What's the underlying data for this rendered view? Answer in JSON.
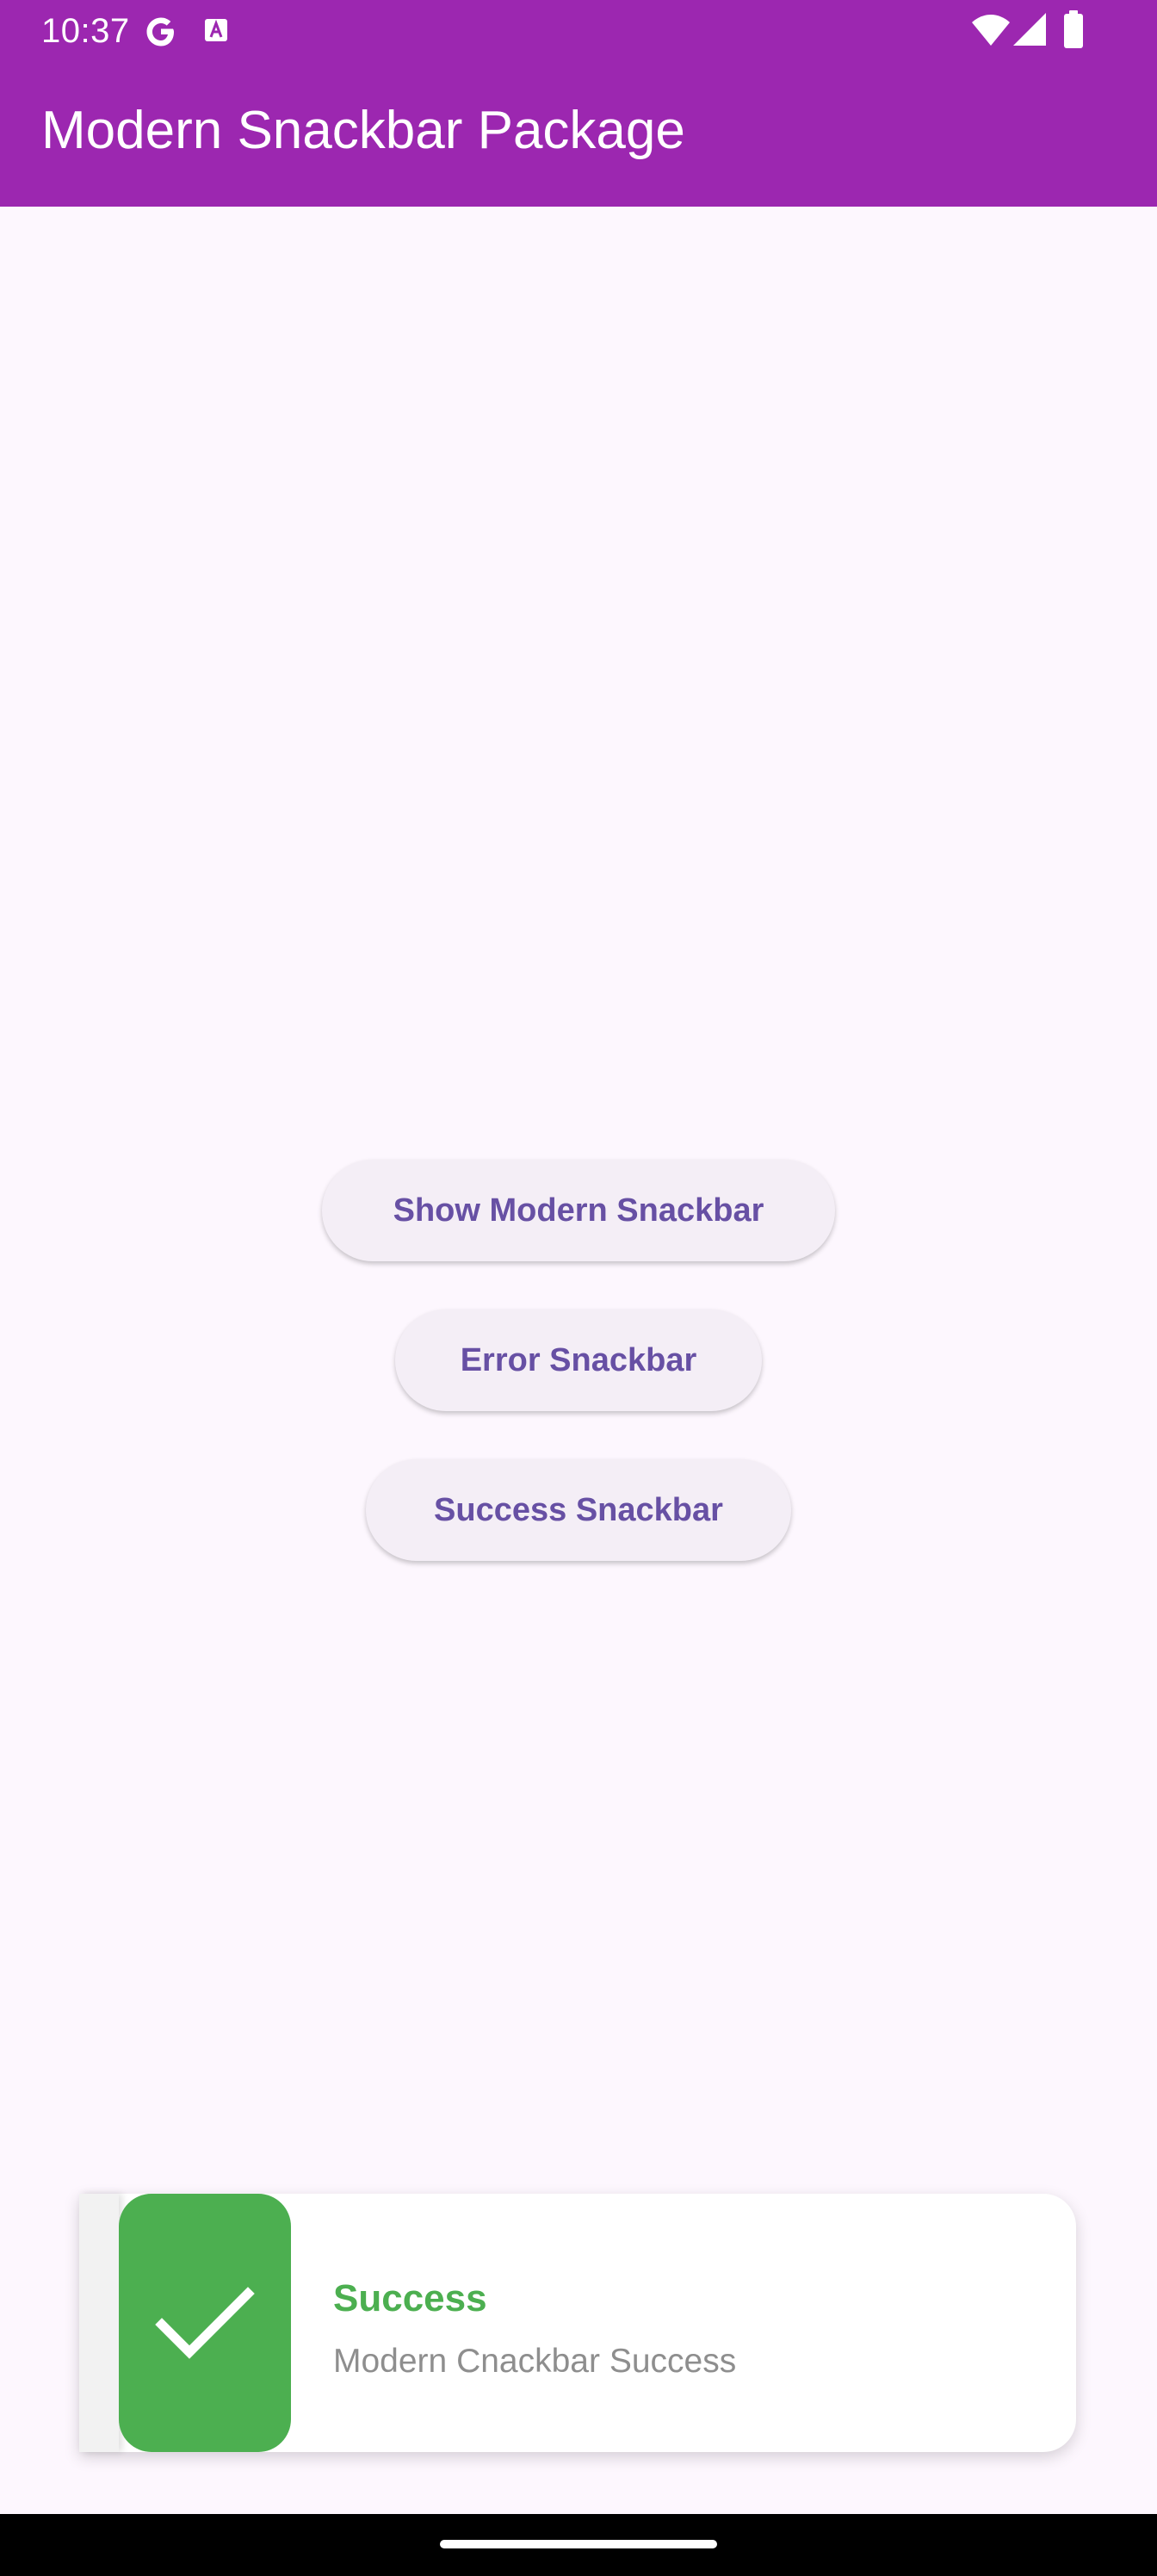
{
  "status_bar": {
    "time": "10:37",
    "icons": [
      "google-g-icon",
      "font-a-icon",
      "wifi-icon",
      "signal-icon",
      "battery-icon"
    ]
  },
  "app_bar": {
    "title": "Modern Snackbar Package",
    "color": "#9C27B0"
  },
  "buttons": [
    {
      "label": "Show Modern Snackbar"
    },
    {
      "label": "Error Snackbar"
    },
    {
      "label": "Success Snackbar"
    }
  ],
  "snackbar": {
    "icon": "check-icon",
    "title": "Success",
    "message": "Modern Cnackbar Success",
    "accent_color": "#4CAF50"
  },
  "colors": {
    "background": "#FDF7FE",
    "button_text": "#6750A4",
    "button_bg": "#F4EEF6"
  }
}
